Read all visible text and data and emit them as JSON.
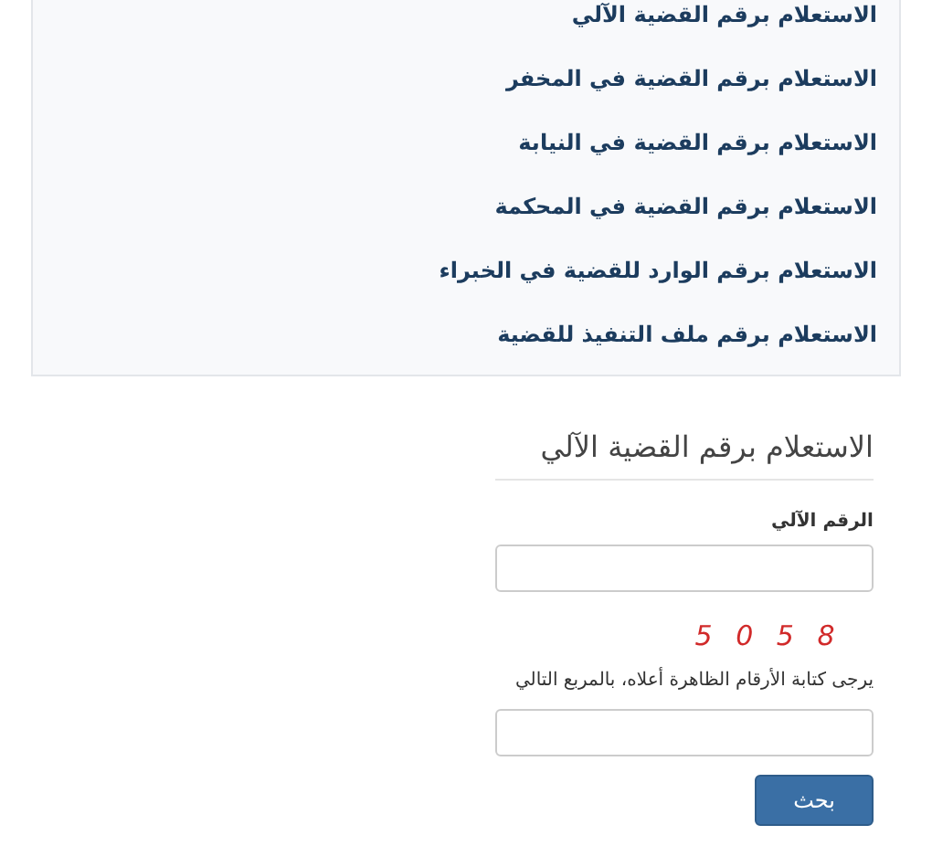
{
  "links": [
    "الاستعلام برقم القضية الآلي",
    "الاستعلام برقم القضية في المخفر",
    "الاستعلام برقم القضية في النيابة",
    "الاستعلام برقم القضية في المحكمة",
    "الاستعلام برقم الوارد للقضية في الخبراء",
    "الاستعلام برقم ملف التنفيذ للقضية"
  ],
  "form": {
    "title": "الاستعلام برقم القضية الآلي",
    "number_label": "الرقم الآلي",
    "captcha": "5 0 5 8",
    "captcha_hint": "يرجى كتابة الأرقام الظاهرة أعلاه، بالمربع التالي",
    "submit": "بحث"
  }
}
